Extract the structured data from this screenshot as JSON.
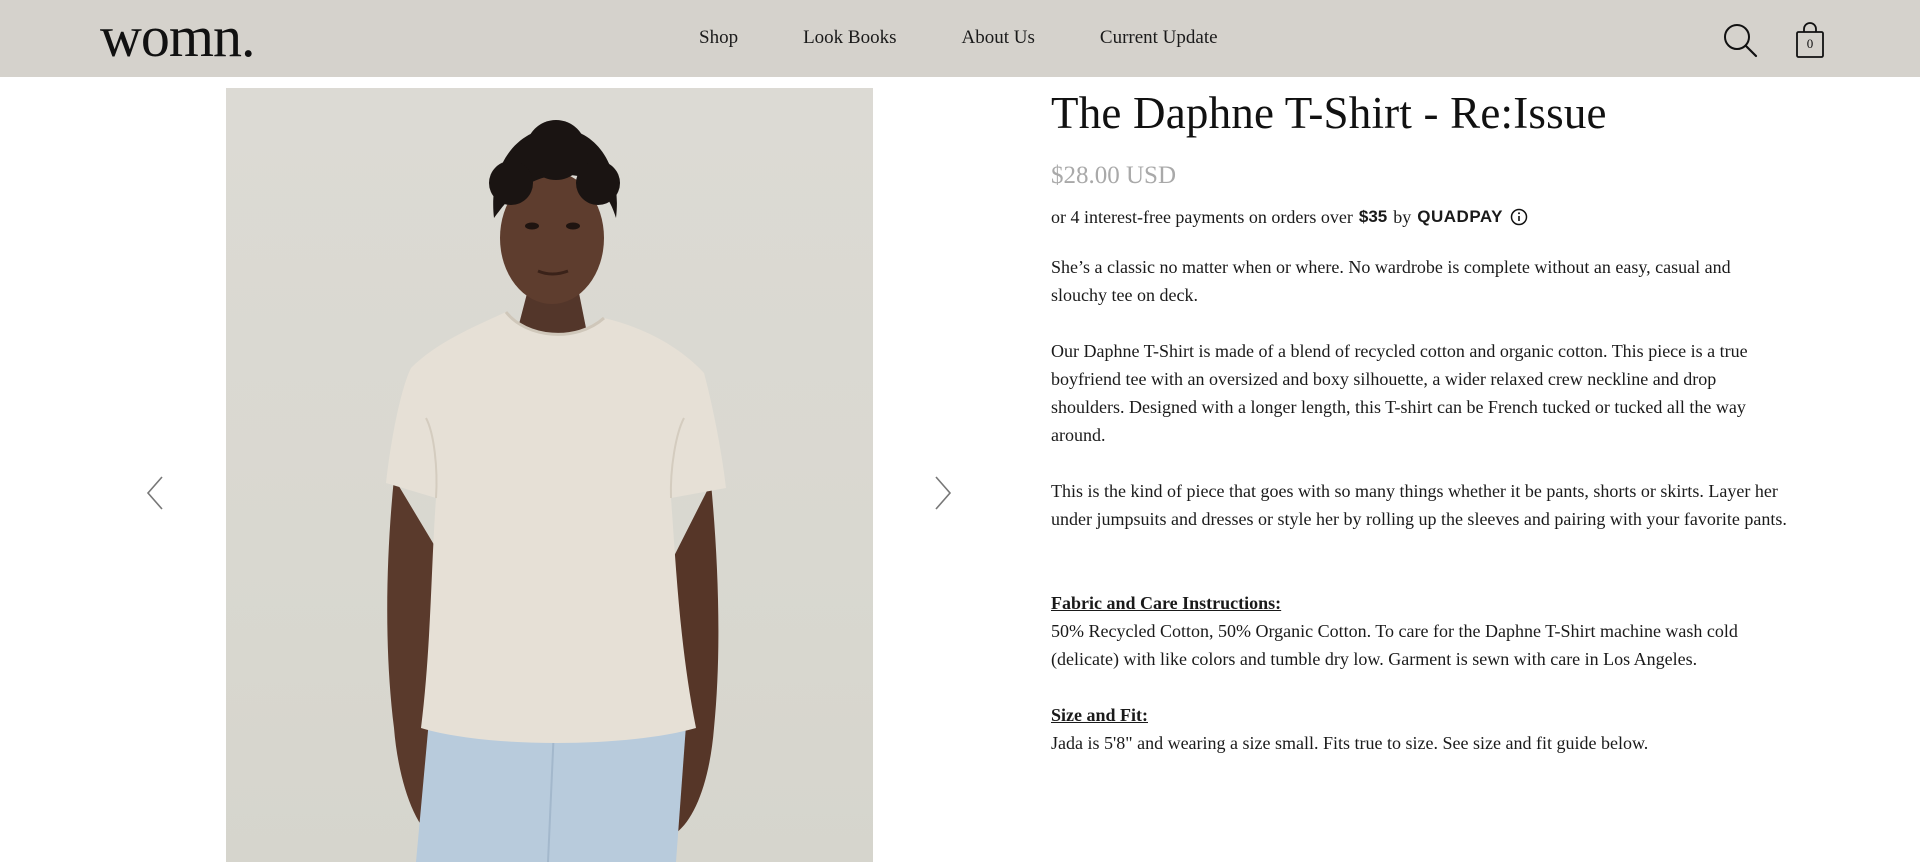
{
  "header": {
    "logo": "womn.",
    "nav": [
      "Shop",
      "Look Books",
      "About Us",
      "Current Update"
    ],
    "cart_count": "0",
    "icons": {
      "search": "search-icon",
      "cart": "shopping-bag-icon"
    }
  },
  "gallery": {
    "prev_icon": "chevron-left-icon",
    "next_icon": "chevron-right-icon"
  },
  "product": {
    "title": "The Daphne T-Shirt - Re:Issue",
    "price": "$28.00 USD",
    "installments": {
      "text": "or 4 interest-free payments on orders over",
      "amount": "$35",
      "by": "by",
      "provider": "QUADPAY"
    },
    "description": [
      "She’s a classic no matter when or where. No wardrobe is complete without an easy, casual and slouchy tee on deck.",
      "Our Daphne T-Shirt is made of a blend of recycled cotton and organic cotton. This piece is a true boyfriend tee with an oversized and boxy silhouette, a wider relaxed crew neckline and drop shoulders. Designed with a longer length, this T-shirt can be French tucked or tucked all the way around.",
      "This is the kind of piece that goes with so many things whether it be pants, shorts or skirts. Layer her under jumpsuits and dresses or style her by rolling up the sleeves and pairing with your favorite pants."
    ],
    "fabric": {
      "heading": "Fabric and Care Instructions:",
      "text": "50% Recycled Cotton, 50% Organic Cotton. To care for the Daphne T-Shirt machine wash cold (delicate) with like colors and tumble dry low. Garment is sewn with care in Los Angeles."
    },
    "size": {
      "heading": "Size and Fit:",
      "text": "Jada is 5'8\" and wearing a size small. Fits true to size. See size and fit guide below."
    }
  },
  "colors": {
    "header_bg": "#d5d2cc",
    "price": "#a9a9a9",
    "text": "#1a1a1a"
  }
}
